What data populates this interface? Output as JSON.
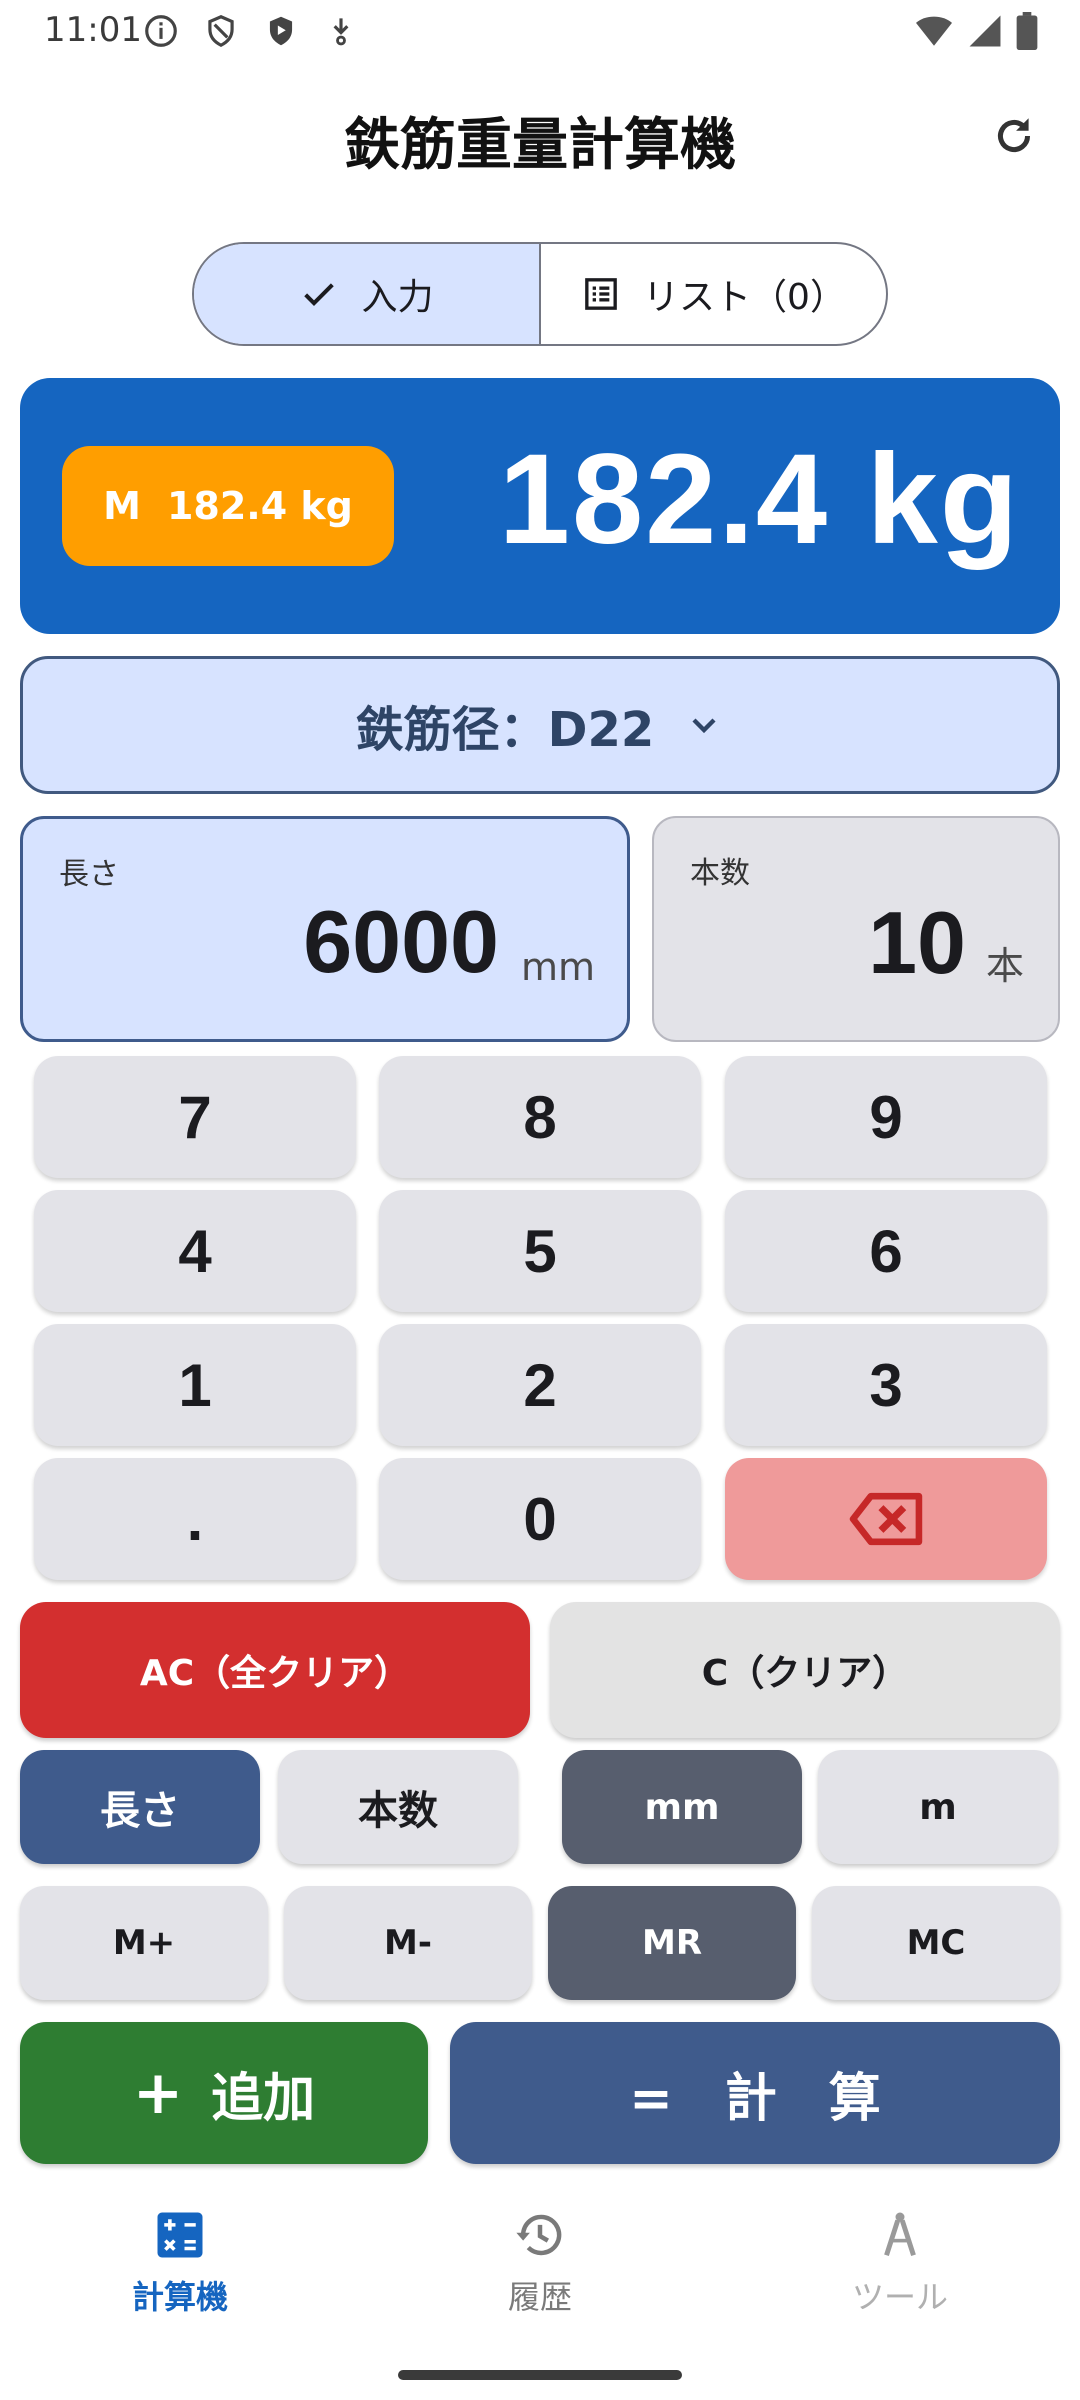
{
  "status_bar": {
    "time": "11:01"
  },
  "top_bar": {
    "title": "鉄筋重量計算機"
  },
  "segmented": {
    "input_label": "入力",
    "list_label": "リスト（0）"
  },
  "result": {
    "memory_prefix": "M",
    "memory_value": "182.4 kg",
    "total": "182.4 kg"
  },
  "diameter": {
    "label": "鉄筋径：D22"
  },
  "fields": {
    "length": {
      "label": "長さ",
      "value": "6000",
      "unit": "mm"
    },
    "count": {
      "label": "本数",
      "value": "10",
      "unit": "本"
    }
  },
  "keypad": {
    "k7": "7",
    "k8": "8",
    "k9": "9",
    "k4": "4",
    "k5": "5",
    "k6": "6",
    "k1": "1",
    "k2": "2",
    "k3": "3",
    "kdot": ".",
    "k0": "0"
  },
  "actions": {
    "all_clear": "AC（全クリア）",
    "clear": "C（クリア）",
    "mode_length": "長さ",
    "mode_count": "本数",
    "unit_mm": "mm",
    "unit_m": "m",
    "mem_plus": "M+",
    "mem_minus": "M-",
    "mem_recall": "MR",
    "mem_clear": "MC",
    "add_icon": "+",
    "add": "追加",
    "calc": "=　計　算"
  },
  "bottom_nav": {
    "calculator": "計算機",
    "history": "履歴",
    "tools": "ツール"
  },
  "colors": {
    "primary": "#1565c0",
    "accent_orange": "#ff9e00",
    "danger": "#d32f2f",
    "success": "#2e7d32",
    "selected_blue": "#3f5b8c",
    "selected_gray": "#575e6e"
  }
}
